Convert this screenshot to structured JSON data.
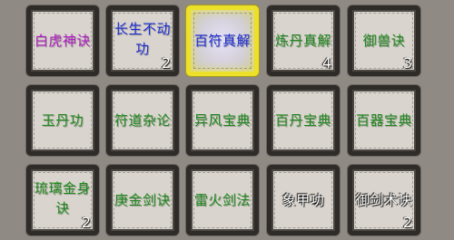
{
  "colors": {
    "purple": "#b01fc4",
    "blue": "#1e2fd6",
    "green": "#1f8a1f",
    "white": "#ffffff",
    "selected_border": "#ece02a"
  },
  "skills": [
    {
      "id": "s0",
      "name": "白虎神诀",
      "color": "purple",
      "count": ""
    },
    {
      "id": "s1",
      "name": "长生不动功",
      "color": "blue",
      "count": "2"
    },
    {
      "id": "s2",
      "name": "百符真解",
      "color": "blue",
      "count": "",
      "selected": true
    },
    {
      "id": "s3",
      "name": "炼丹真解",
      "color": "green",
      "count": "4"
    },
    {
      "id": "s4",
      "name": "御兽诀",
      "color": "green",
      "count": "3"
    },
    {
      "id": "s5",
      "name": "玉丹功",
      "color": "green",
      "count": ""
    },
    {
      "id": "s6",
      "name": "符道杂论",
      "color": "green",
      "count": ""
    },
    {
      "id": "s7",
      "name": "异风宝典",
      "color": "green",
      "count": ""
    },
    {
      "id": "s8",
      "name": "百丹宝典",
      "color": "green",
      "count": ""
    },
    {
      "id": "s9",
      "name": "百器宝典",
      "color": "green",
      "count": ""
    },
    {
      "id": "s10",
      "name": "琉璃金身诀",
      "color": "green",
      "count": "2"
    },
    {
      "id": "s11",
      "name": "庚金剑诀",
      "color": "green",
      "count": ""
    },
    {
      "id": "s12",
      "name": "雷火剑法",
      "color": "green",
      "count": ""
    },
    {
      "id": "s13",
      "name": "象甲功",
      "color": "white",
      "count": ""
    },
    {
      "id": "s14",
      "name": "御剑术诀",
      "color": "white",
      "count": "2"
    }
  ]
}
